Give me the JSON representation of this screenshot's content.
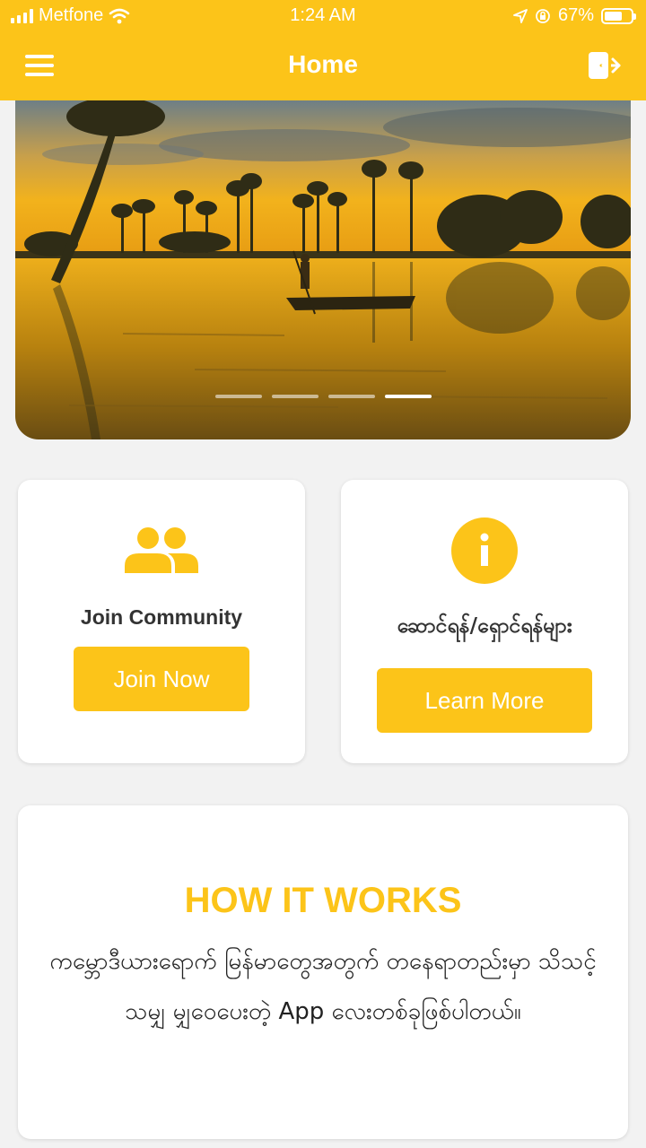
{
  "status_bar": {
    "carrier": "Metfone",
    "time": "1:24 AM",
    "battery_text": "67%",
    "battery_level": 0.67
  },
  "app_bar": {
    "title": "Home",
    "menu_icon": "hamburger-menu-icon",
    "logout_icon": "logout-icon"
  },
  "banner": {
    "slide_count": 4,
    "active_slide": 4
  },
  "community_card": {
    "icon": "people-icon",
    "title": "Join Community",
    "button_label": "Join Now"
  },
  "info_card": {
    "icon": "info-icon",
    "title": "ဆောင်ရန်/ရှောင်ရန်များ",
    "button_label": "Learn More"
  },
  "how_it_works": {
    "title": "HOW IT WORKS",
    "description": "ကမ္ဘောဒီယားရောက် မြန်မာတွေအတွက် တနေရာတည်းမှာ သိသင့်သမျှ မျှဝေပေးတဲ့ App လေးတစ်ခုဖြစ်ပါတယ်။"
  },
  "colors": {
    "accent": "#fcc419",
    "background": "#f2f2f2",
    "card": "#ffffff"
  }
}
